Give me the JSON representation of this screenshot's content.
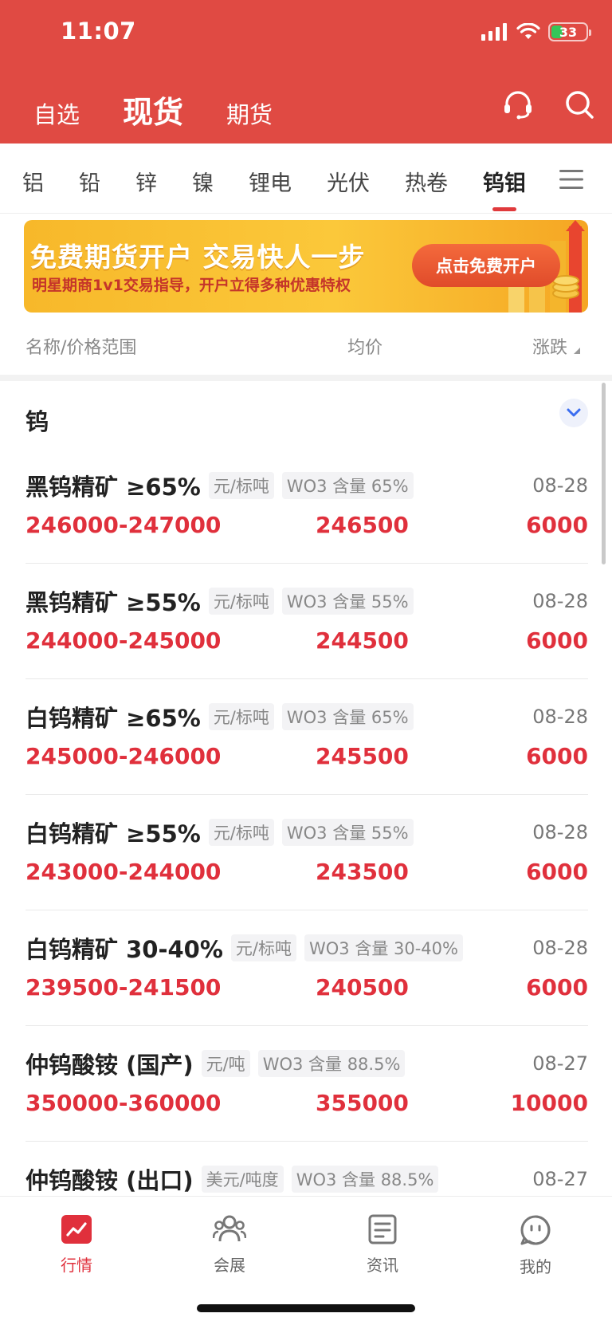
{
  "status_bar": {
    "time": "11:07",
    "battery": "33"
  },
  "header": {
    "tabs": [
      {
        "label": "自选",
        "active": false
      },
      {
        "label": "现货",
        "active": true
      },
      {
        "label": "期货",
        "active": false
      }
    ]
  },
  "categories": [
    "铝",
    "铅",
    "锌",
    "镍",
    "锂电",
    "光伏",
    "热卷",
    "钨钼"
  ],
  "active_category": "钨钼",
  "banner": {
    "title": "免费期货开户   交易快人一步",
    "subtitle": "明星期商1v1交易指导，开户立得多种优惠特权",
    "button": "点击免费开户"
  },
  "columns": {
    "name": "名称/价格范围",
    "avg": "均价",
    "change": "涨跌"
  },
  "section": {
    "title": "钨"
  },
  "rows": [
    {
      "name": "黑钨精矿 ≥65%",
      "unit": "元/标吨",
      "spec": "WO3 含量 65%",
      "date": "08-28",
      "range": "246000-247000",
      "avg": "246500",
      "change": "6000"
    },
    {
      "name": "黑钨精矿 ≥55%",
      "unit": "元/标吨",
      "spec": "WO3 含量 55%",
      "date": "08-28",
      "range": "244000-245000",
      "avg": "244500",
      "change": "6000"
    },
    {
      "name": "白钨精矿 ≥65%",
      "unit": "元/标吨",
      "spec": "WO3 含量 65%",
      "date": "08-28",
      "range": "245000-246000",
      "avg": "245500",
      "change": "6000"
    },
    {
      "name": "白钨精矿 ≥55%",
      "unit": "元/标吨",
      "spec": "WO3 含量 55%",
      "date": "08-28",
      "range": "243000-244000",
      "avg": "243500",
      "change": "6000"
    },
    {
      "name": "白钨精矿 30-40%",
      "unit": "元/标吨",
      "spec": "WO3 含量 30-40%",
      "date": "08-28",
      "range": "239500-241500",
      "avg": "240500",
      "change": "6000"
    },
    {
      "name": "仲钨酸铵 (国产)",
      "unit": "元/吨",
      "spec": "WO3 含量 88.5%",
      "date": "08-27",
      "range": "350000-360000",
      "avg": "355000",
      "change": "10000"
    },
    {
      "name": "仲钨酸铵 (出口)",
      "unit": "美元/吨度",
      "spec": "WO3 含量 88.5%",
      "date": "08-27",
      "range": "",
      "avg": "",
      "change": ""
    }
  ],
  "bottom_nav": [
    {
      "label": "行情",
      "icon": "chart-icon",
      "active": true
    },
    {
      "label": "会展",
      "icon": "people-icon",
      "active": false
    },
    {
      "label": "资讯",
      "icon": "news-icon",
      "active": false
    },
    {
      "label": "我的",
      "icon": "profile-icon",
      "active": false
    }
  ],
  "colors": {
    "header_red": "#e04a43",
    "price_red": "#e0303c",
    "banner_yellow": "#fbc83a"
  }
}
